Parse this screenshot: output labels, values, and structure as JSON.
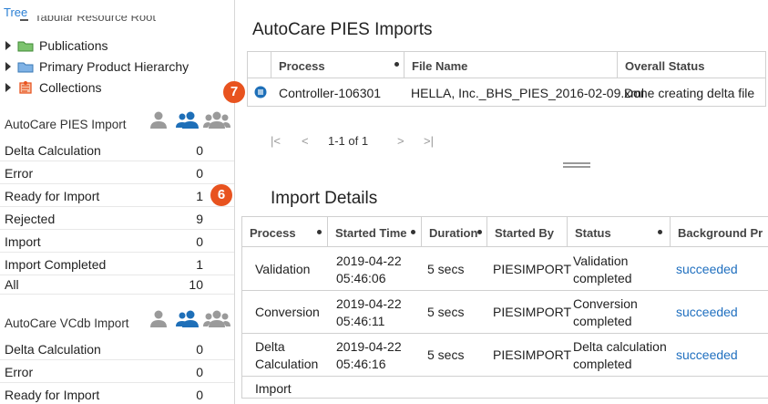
{
  "sidebar": {
    "tab_label": "Tree",
    "cut_label": "Tabular Resource Root",
    "tree_items": [
      {
        "label": "Publications",
        "icon": "green-folder-icon",
        "color": "#5cb85c"
      },
      {
        "label": "Primary Product Hierarchy",
        "icon": "blue-folder-icon",
        "color": "#5b9bd5"
      },
      {
        "label": "Collections",
        "icon": "collections-icon",
        "color": "#e8531f"
      }
    ],
    "pies_section": {
      "title": "AutoCare PIES Import",
      "rows": [
        {
          "label": "Delta Calculation",
          "count": "0"
        },
        {
          "label": "Error",
          "count": "0"
        },
        {
          "label": "Ready for Import",
          "count": "1"
        },
        {
          "label": "Rejected",
          "count": "9"
        },
        {
          "label": "Import",
          "count": "0"
        },
        {
          "label": "Import Completed",
          "count": "1"
        },
        {
          "label": "All",
          "count": "10"
        }
      ]
    },
    "vcdb_section": {
      "title": "AutoCare VCdb Import",
      "rows": [
        {
          "label": "Delta Calculation",
          "count": "0"
        },
        {
          "label": "Error",
          "count": "0"
        },
        {
          "label": "Ready for Import",
          "count": "0"
        }
      ]
    }
  },
  "badges": {
    "six": "6",
    "seven": "7"
  },
  "main": {
    "title": "AutoCare PIES Imports",
    "imports_grid": {
      "columns": [
        "Process",
        "File Name",
        "Overall Status"
      ],
      "rows": [
        {
          "process": "Controller-106301",
          "file": "HELLA, Inc._BHS_PIES_2016-02-09.xml",
          "status": "Done creating delta file"
        }
      ]
    },
    "pager": {
      "first": "|<",
      "prev": "<",
      "range": "1-1 of 1",
      "next": ">",
      "last": ">|"
    },
    "details_title": "Import Details",
    "details_grid": {
      "columns": [
        "Process",
        "Started Time",
        "Duration",
        "Started By",
        "Status",
        "Background Pr"
      ],
      "rows": [
        {
          "process": [
            "Validation",
            ""
          ],
          "time": [
            "2019-04-22",
            "05:46:06"
          ],
          "duration": "5 secs",
          "by": "PIESIMPORT",
          "status": [
            "Validation",
            "completed"
          ],
          "bg": "succeeded"
        },
        {
          "process": [
            "Conversion",
            ""
          ],
          "time": [
            "2019-04-22",
            "05:46:11"
          ],
          "duration": "5 secs",
          "by": "PIESIMPORT",
          "status": [
            "Conversion",
            "completed"
          ],
          "bg": "succeeded"
        },
        {
          "process": [
            "Delta",
            "Calculation"
          ],
          "time": [
            "2019-04-22",
            "05:46:16"
          ],
          "duration": "5 secs",
          "by": "PIESIMPORT",
          "status": [
            "Delta calculation",
            "completed"
          ],
          "bg": "succeeded"
        },
        {
          "process": [
            "Import",
            ""
          ]
        }
      ]
    }
  },
  "colors": {
    "accent": "#1f6fbf",
    "badge": "#e8531f",
    "role_active": "#1e6fb8",
    "role_inactive": "#9a9a9a"
  }
}
